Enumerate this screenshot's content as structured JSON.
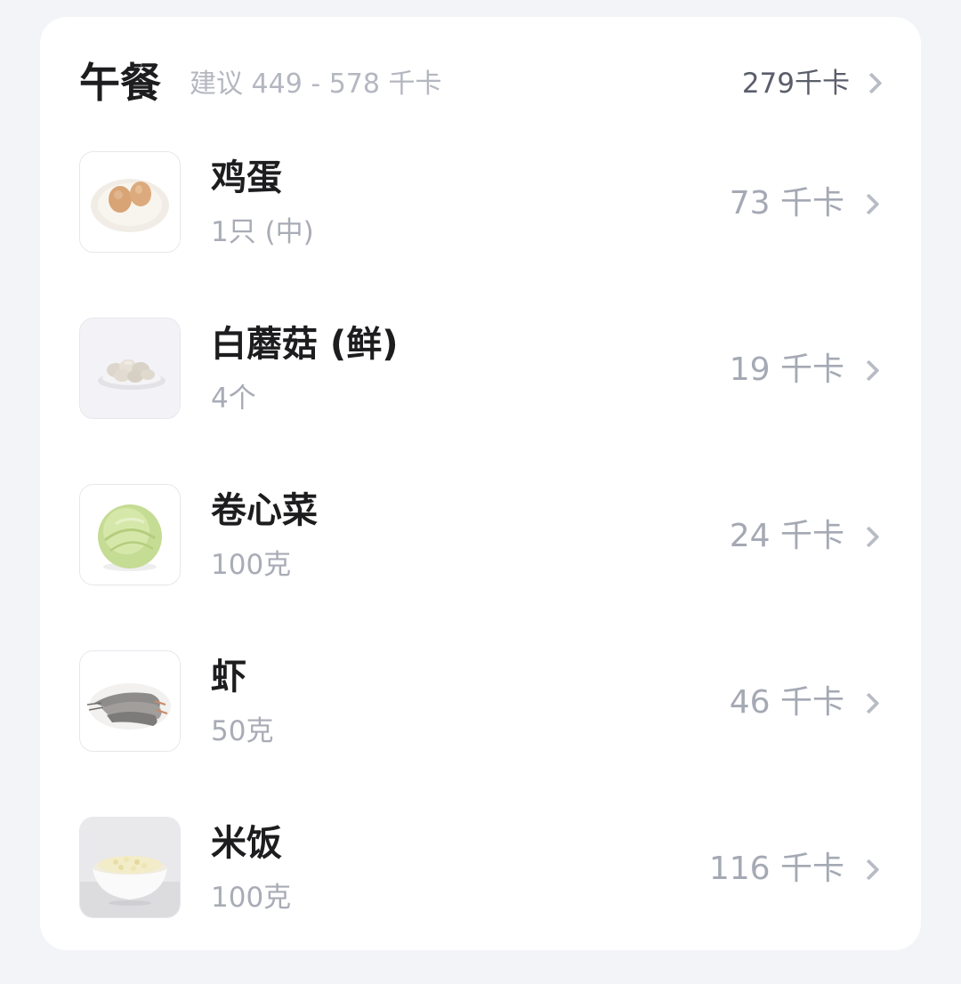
{
  "meal": {
    "title": "午餐",
    "suggestion": "建议 449 - 578 千卡",
    "total": "279千卡"
  },
  "foods": [
    {
      "name": "鸡蛋",
      "portion": "1只 (中)",
      "kcal": "73 千卡",
      "image": "eggs-on-plate"
    },
    {
      "name": "白蘑菇 (鲜)",
      "portion": "4个",
      "kcal": "19 千卡",
      "image": "mushrooms-on-plate"
    },
    {
      "name": "卷心菜",
      "portion": "100克",
      "kcal": "24 千卡",
      "image": "cabbage"
    },
    {
      "name": "虾",
      "portion": "50克",
      "kcal": "46 千卡",
      "image": "shrimp"
    },
    {
      "name": "米饭",
      "portion": "100克",
      "kcal": "116 千卡",
      "image": "rice-bowl"
    }
  ],
  "icons": {
    "chevron": "chevron-right-icon"
  },
  "colors": {
    "background": "#f3f4f8",
    "card": "#ffffff",
    "primary_text": "#1d1d1f",
    "secondary_text": "#a9acb6"
  }
}
